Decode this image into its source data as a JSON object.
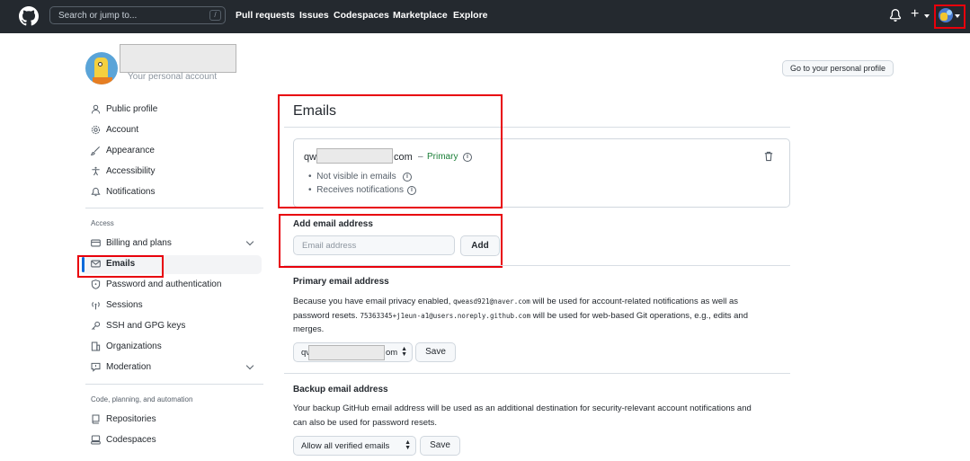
{
  "header": {
    "search_placeholder": "Search or jump to...",
    "search_key": "/",
    "nav": [
      "Pull requests",
      "Issues",
      "Codespaces",
      "Marketplace",
      "Explore"
    ]
  },
  "profile": {
    "subtitle": "Your personal account",
    "go_button": "Go to your personal profile"
  },
  "sidebar": {
    "group1": [
      {
        "label": "Public profile",
        "icon": "person-icon"
      },
      {
        "label": "Account",
        "icon": "gear-icon"
      },
      {
        "label": "Appearance",
        "icon": "paintbrush-icon"
      },
      {
        "label": "Accessibility",
        "icon": "accessibility-icon"
      },
      {
        "label": "Notifications",
        "icon": "bell-icon"
      }
    ],
    "access_heading": "Access",
    "group2": [
      {
        "label": "Billing and plans",
        "icon": "credit-card-icon"
      },
      {
        "label": "Emails",
        "icon": "mail-icon"
      },
      {
        "label": "Password and authentication",
        "icon": "shield-lock-icon"
      },
      {
        "label": "Sessions",
        "icon": "broadcast-icon"
      },
      {
        "label": "SSH and GPG keys",
        "icon": "key-icon"
      },
      {
        "label": "Organizations",
        "icon": "organization-icon"
      },
      {
        "label": "Moderation",
        "icon": "report-icon"
      }
    ],
    "code_heading": "Code, planning, and automation",
    "group3": [
      {
        "label": "Repositories",
        "icon": "repo-icon"
      },
      {
        "label": "Codespaces",
        "icon": "codespaces-icon"
      }
    ]
  },
  "main": {
    "title": "Emails",
    "email_start": "qw",
    "email_end": "com",
    "dash": "–",
    "primary_label": "Primary",
    "bullets": [
      "Not visible in emails",
      "Receives notifications"
    ],
    "add_heading": "Add email address",
    "add_placeholder": "Email address",
    "add_button": "Add",
    "primary_heading": "Primary email address",
    "primary_p1": "Because you have email privacy enabled,",
    "primary_addr1": "qweasd921@naver.com",
    "primary_p2": "will be used for account-related notifications as well as",
    "primary_p3": "password resets.",
    "primary_addr2": "75363345+j1eun-a1@users.noreply.github.com",
    "primary_p4": "will be used for web-based Git operations, e.g., edits and",
    "primary_p5": "merges.",
    "primary_select_start": "qv",
    "primary_select_end": "om",
    "save_label": "Save",
    "backup_heading": "Backup email address",
    "backup_p1": "Your backup GitHub email address will be used as an additional destination for security-relevant account notifications and",
    "backup_p2": "can also be used for password resets.",
    "backup_select": "Allow all verified emails"
  },
  "colors": {
    "highlight": "#e8000b",
    "accent": "#0969da",
    "primary_green": "#1a7f37"
  }
}
